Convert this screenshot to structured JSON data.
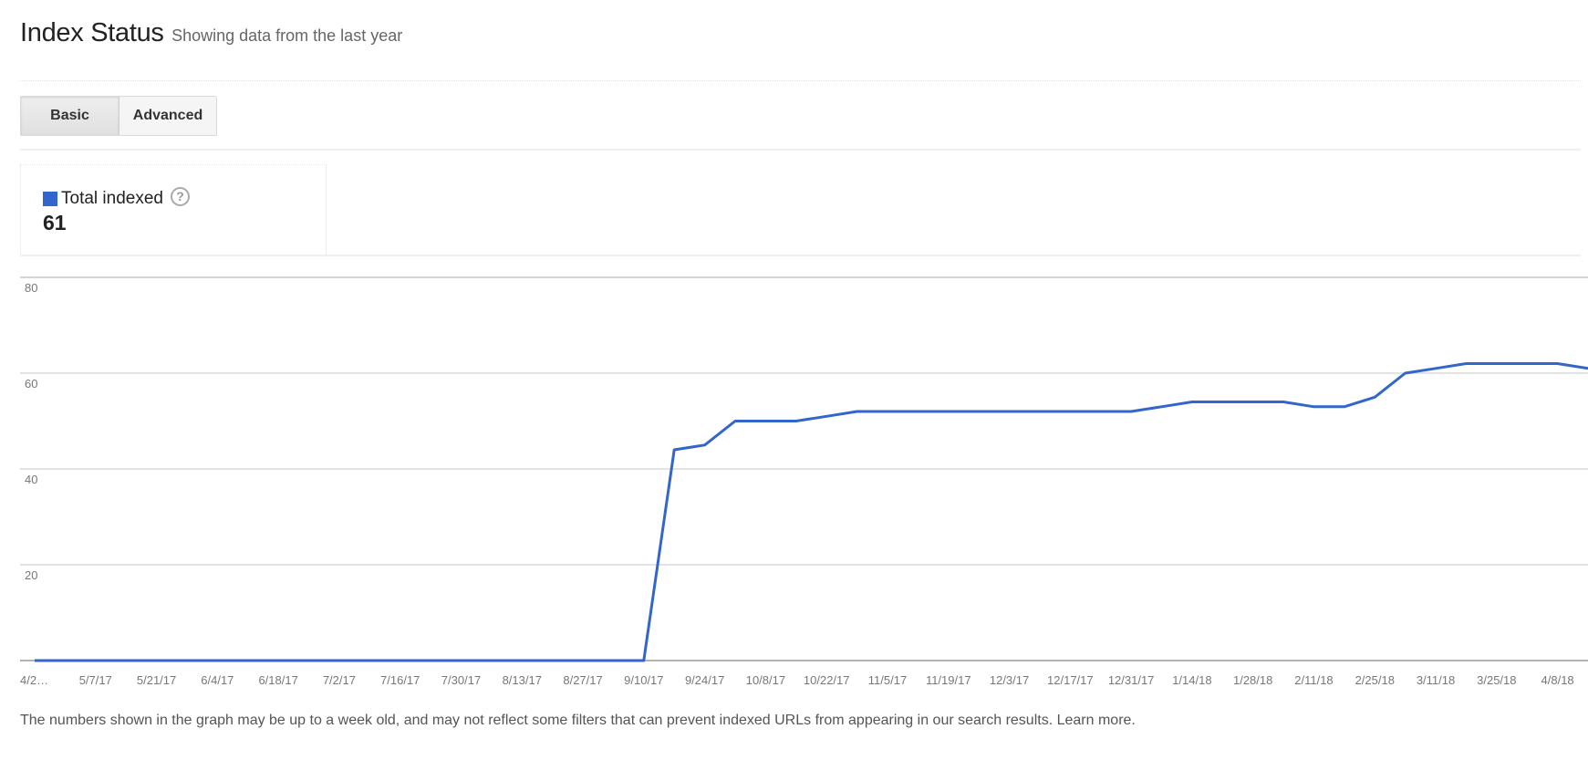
{
  "header": {
    "title": "Index Status",
    "subtitle": "Showing data from the last year"
  },
  "tabs": [
    {
      "label": "Basic",
      "selected": true
    },
    {
      "label": "Advanced",
      "selected": false
    }
  ],
  "stat": {
    "label": "Total indexed",
    "value": "61",
    "color": "#3366cc",
    "help_icon": "question-circle-icon"
  },
  "footnote": {
    "text": "The numbers shown in the graph may be up to a week old, and may not reflect some filters that can prevent indexed URLs from appearing in our search results. ",
    "link": "Learn more."
  },
  "chart_data": {
    "type": "line",
    "title": "",
    "xlabel": "",
    "ylabel": "",
    "ylim": [
      0,
      80
    ],
    "yticks": [
      20,
      40,
      60,
      80
    ],
    "grid": true,
    "legend": "none",
    "x_tick_labels": [
      "4/2…",
      "5/7/17",
      "5/21/17",
      "6/4/17",
      "6/18/17",
      "7/2/17",
      "7/16/17",
      "7/30/17",
      "8/13/17",
      "8/27/17",
      "9/10/17",
      "9/24/17",
      "10/8/17",
      "10/22/17",
      "11/5/17",
      "11/19/17",
      "12/3/17",
      "12/17/17",
      "12/31/17",
      "1/14/18",
      "1/28/18",
      "2/11/18",
      "2/25/18",
      "3/11/18",
      "3/25/18",
      "4/8/18"
    ],
    "x": [
      "4/23/17",
      "4/30/17",
      "5/7/17",
      "5/14/17",
      "5/21/17",
      "5/28/17",
      "6/4/17",
      "6/11/17",
      "6/18/17",
      "6/25/17",
      "7/2/17",
      "7/9/17",
      "7/16/17",
      "7/23/17",
      "7/30/17",
      "8/6/17",
      "8/13/17",
      "8/20/17",
      "8/27/17",
      "9/3/17",
      "9/10/17",
      "9/17/17",
      "9/24/17",
      "10/1/17",
      "10/8/17",
      "10/15/17",
      "10/22/17",
      "10/29/17",
      "11/5/17",
      "11/12/17",
      "11/19/17",
      "11/26/17",
      "12/3/17",
      "12/10/17",
      "12/17/17",
      "12/24/17",
      "12/31/17",
      "1/7/18",
      "1/14/18",
      "1/21/18",
      "1/28/18",
      "2/4/18",
      "2/11/18",
      "2/18/18",
      "2/25/18",
      "3/4/18",
      "3/11/18",
      "3/18/18",
      "3/25/18",
      "4/1/18",
      "4/8/18",
      "4/15/18"
    ],
    "series": [
      {
        "name": "Total indexed",
        "color": "#3366cc",
        "values": [
          0,
          0,
          0,
          0,
          0,
          0,
          0,
          0,
          0,
          0,
          0,
          0,
          0,
          0,
          0,
          0,
          0,
          0,
          0,
          0,
          0,
          44,
          45,
          50,
          50,
          50,
          51,
          52,
          52,
          52,
          52,
          52,
          52,
          52,
          52,
          52,
          52,
          53,
          54,
          54,
          54,
          54,
          53,
          53,
          55,
          60,
          61,
          62,
          62,
          62,
          62,
          61
        ]
      }
    ]
  }
}
